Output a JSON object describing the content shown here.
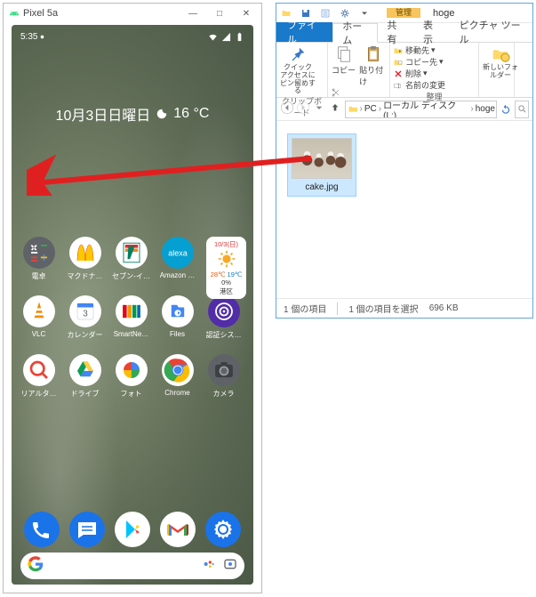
{
  "emulator": {
    "title": "Pixel 5a",
    "status": {
      "time": "5:35"
    },
    "date_line": {
      "date": "10月3日日曜日",
      "temp": "16 °C"
    },
    "apps": {
      "row1": [
        "電卓",
        "マクドナ…",
        "セブン-イ…",
        "Amazon …"
      ],
      "row2": [
        "VLC",
        "カレンダー",
        "SmartNe…",
        "Files",
        "認証シス…"
      ],
      "row3": [
        "リアルタ…",
        "ドライブ",
        "フォト",
        "Chrome",
        "カメラ"
      ]
    },
    "weather": {
      "day": "10/3(日)",
      "hi": "28℃",
      "lo": "19℃",
      "pop": "0%",
      "place": "港区"
    },
    "search_placeholder": ""
  },
  "explorer": {
    "context_tab": "管理",
    "context_sub": "ピクチャ ツール",
    "window_label": "hoge",
    "tabs": {
      "file": "ファイル",
      "home": "ホーム",
      "share": "共有",
      "view": "表示"
    },
    "ribbon": {
      "pin": "クイック アクセスにピン留めする",
      "copy": "コピー",
      "paste": "貼り付け",
      "moveto": "移動先",
      "copyto": "コピー先",
      "delete": "削除",
      "rename": "名前の変更",
      "newfolder": "新しいフォルダー",
      "grp_clip": "クリップボード",
      "grp_org": "整理"
    },
    "breadcrumbs": [
      "PC",
      "ローカル ディスク (L:)",
      "hoge"
    ],
    "file": {
      "name": "cake.jpg"
    },
    "status": {
      "count": "1 個の項目",
      "selected": "1 個の項目を選択",
      "size": "696 KB"
    }
  }
}
